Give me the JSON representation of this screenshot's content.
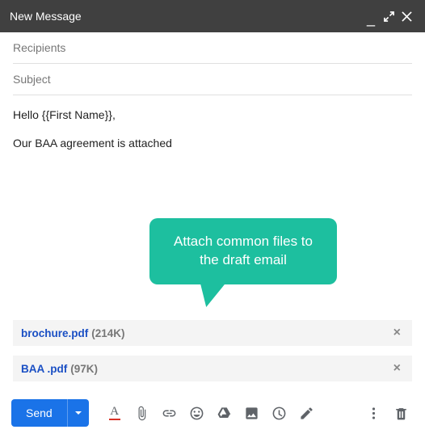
{
  "window": {
    "title": "New Message"
  },
  "fields": {
    "recipients_placeholder": "Recipients",
    "subject_placeholder": "Subject"
  },
  "body": {
    "line1": "Hello {{First Name}},",
    "line2": "Our BAA agreement is attached"
  },
  "callout": {
    "text": "Attach common files to the draft email"
  },
  "attachments": [
    {
      "name": "brochure.pdf",
      "size": "(214K)"
    },
    {
      "name": "BAA .pdf",
      "size": "(97K)"
    }
  ],
  "toolbar": {
    "send_label": "Send"
  },
  "colors": {
    "accent": "#1a73e8",
    "callout": "#1dbf9f"
  }
}
